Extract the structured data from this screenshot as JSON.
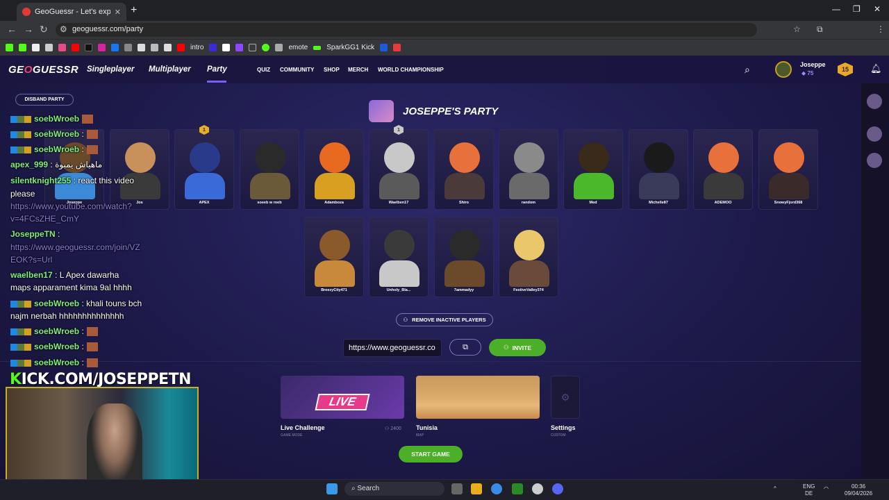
{
  "browser": {
    "tab_title": "GeoGuessr - Let's explore the w",
    "tab_close": "✕",
    "new_tab": "+",
    "url": "geoguessr.com/party",
    "window_min": "—",
    "window_max": "❐",
    "window_close": "✕",
    "bookmarks": [
      "intro",
      "emote",
      "SparkGG1 Kick"
    ]
  },
  "header": {
    "logo_a": "GE",
    "logo_o": "O",
    "logo_b": "GUESSR",
    "nav": [
      "Singleplayer",
      "Multiplayer",
      "Party"
    ],
    "subnav": [
      "QUIZ",
      "COMMUNITY",
      "SHOP",
      "MERCH",
      "WORLD CHAMPIONSHIP"
    ],
    "profile_name": "Joseppe",
    "profile_coins": "75",
    "level": "15"
  },
  "party": {
    "disband_label": "DISBAND PARTY",
    "title": "JOSEPPE'S PARTY",
    "players_row1": [
      {
        "name": "Joseppe",
        "badge": ""
      },
      {
        "name": "Jos",
        "badge": ""
      },
      {
        "name": "APEX",
        "badge": "1"
      },
      {
        "name": "soeeb w roeb",
        "badge": ""
      },
      {
        "name": "Adamboza",
        "badge": ""
      },
      {
        "name": "Waelben17",
        "badge": "1"
      },
      {
        "name": "Shiro",
        "badge": ""
      },
      {
        "name": "random",
        "badge": ""
      },
      {
        "name": "Med",
        "badge": ""
      },
      {
        "name": "Michelle87",
        "badge": ""
      },
      {
        "name": "ADEMOO",
        "badge": ""
      },
      {
        "name": "SnowyFjord368",
        "badge": ""
      }
    ],
    "players_row2": [
      {
        "name": "BreezyCity471"
      },
      {
        "name": "Unholy_Bla..."
      },
      {
        "name": "7ammadyy"
      },
      {
        "name": "FestiveValley374"
      }
    ],
    "remove_inactive_label": "REMOVE INACTIVE PLAYERS",
    "invite_link": "https://www.geoguessr.co",
    "invite_label": "INVITE"
  },
  "chat": [
    {
      "user": "soebWroeb",
      "text": " :",
      "emote": true,
      "badges": true
    },
    {
      "user": "soebWroeb",
      "text": " :",
      "emote": true,
      "badges": true
    },
    {
      "user": "apex_999",
      "text": " : ماهياش يمبوة",
      "emote": false,
      "badges": false
    },
    {
      "user": "silentknight255",
      "text": " : react this video",
      "emote": false,
      "badges": false
    },
    {
      "line": "please"
    },
    {
      "link": "https://www.youtube.com/watch?"
    },
    {
      "link": "v=4FCsZHE_CmY"
    },
    {
      "user": "JoseppeTN",
      "text": " :",
      "emote": false,
      "badges": false
    },
    {
      "link": "https://www.geoguessr.com/join/VZ"
    },
    {
      "link": "EOK?s=Url"
    },
    {
      "user": "waelben17",
      "text": " : L Apex dawarha",
      "emote": false,
      "badges": false
    },
    {
      "line": "maps apparament kima 9al hhhh"
    },
    {
      "user": "soebWroeb",
      "text": " : khali touns bch",
      "emote": false,
      "badges": true
    },
    {
      "line": "najm nerbah hhhhhhhhhhhhhh"
    },
    {
      "user": "soebWroeb",
      "text": " :",
      "emote": true,
      "badges": true
    },
    {
      "user": "soebWroeb",
      "text": " :",
      "emote": true,
      "badges": true
    },
    {
      "user": "soebWroeb",
      "text": " :",
      "emote": true,
      "badges": true
    }
  ],
  "game": {
    "mode_badge": "LIVE",
    "mode_title": "Live Challenge",
    "mode_sub": "GAME MODE",
    "players_count": "2400",
    "map_title": "Tunisia",
    "map_sub": "MAP",
    "settings_title": "Settings",
    "settings_sub": "CUSTOM",
    "start_label": "START GAME"
  },
  "stream": {
    "kick_k": "K",
    "kick_rest": "ICK.COM/JOSEPPETN"
  },
  "taskbar": {
    "search": "Search",
    "lang_1": "ENG",
    "lang_2": "DE",
    "time": "00:36",
    "date": "09/04/2026"
  },
  "colors": {
    "accent_green": "#4caf28",
    "party_purple": "#7a5cff",
    "kick_green": "#53fc18",
    "live_pink": "#e83a8a"
  }
}
